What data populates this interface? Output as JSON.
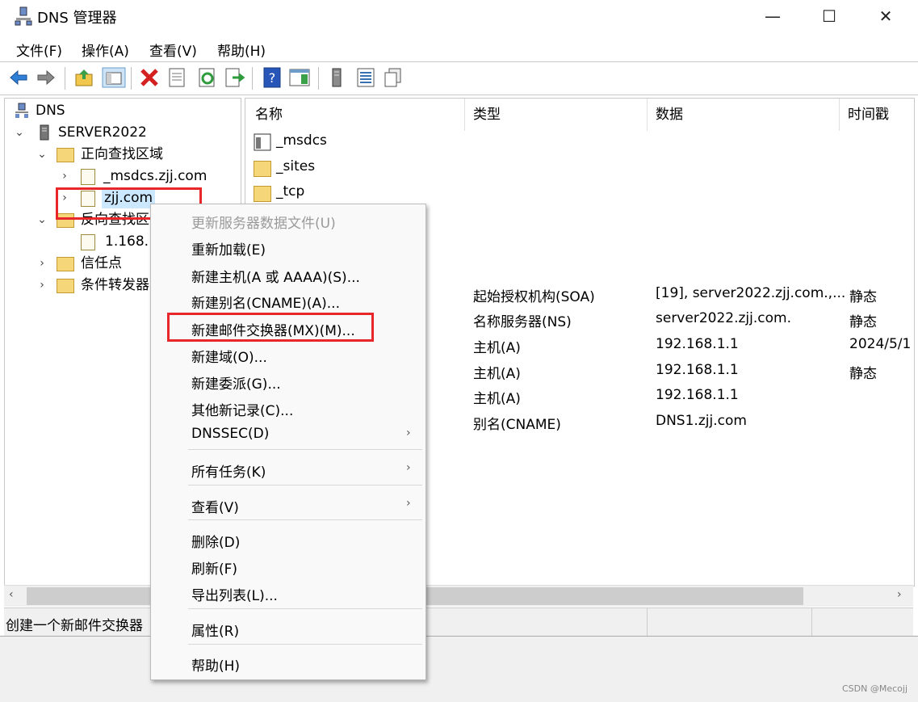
{
  "window": {
    "title": "DNS 管理器",
    "minimize": "—",
    "maximize": "☐",
    "close": "✕"
  },
  "menubar": [
    "文件(F)",
    "操作(A)",
    "查看(V)",
    "帮助(H)"
  ],
  "toolbar_icons": [
    "back-icon",
    "forward-icon",
    "up-folder-icon",
    "show-hide-tree-icon",
    "delete-icon",
    "properties-icon",
    "refresh-icon",
    "export-icon",
    "help-icon",
    "action-pane-icon",
    "server-icon",
    "list-icon",
    "copy-icon"
  ],
  "tree": {
    "root": "DNS",
    "server": "SERVER2022",
    "forward_zones": "正向查找区域",
    "zone_msdcs": "_msdcs.zjj.com",
    "zone_zjj": "zjj.com",
    "reverse_zones": "反向查找区",
    "reverse_zone": "1.168.1",
    "trust_points": "信任点",
    "conditional_forwarders": "条件转发器"
  },
  "list": {
    "columns": [
      "名称",
      "类型",
      "数据",
      "时间戳"
    ],
    "folders": [
      "_msdcs",
      "_sites",
      "_tcp"
    ],
    "records": [
      {
        "type": "起始授权机构(SOA)",
        "data": "[19], server2022.zjj.com.,...",
        "timestamp": "静态"
      },
      {
        "type": "名称服务器(NS)",
        "data": "server2022.zjj.com.",
        "timestamp": "静态"
      },
      {
        "type": "主机(A)",
        "data": "192.168.1.1",
        "timestamp": "2024/5/1"
      },
      {
        "type": "主机(A)",
        "data": "192.168.1.1",
        "timestamp": "静态"
      },
      {
        "type": "主机(A)",
        "data": "192.168.1.1",
        "timestamp": ""
      },
      {
        "type": "别名(CNAME)",
        "data": "DNS1.zjj.com",
        "timestamp": ""
      }
    ]
  },
  "context_menu": {
    "update": "更新服务器数据文件(U)",
    "reload": "重新加载(E)",
    "new_host": "新建主机(A 或 AAAA)(S)...",
    "new_alias": "新建别名(CNAME)(A)...",
    "new_mx": "新建邮件交换器(MX)(M)...",
    "new_domain": "新建域(O)...",
    "new_delegation": "新建委派(G)...",
    "other_records": "其他新记录(C)...",
    "dnssec": "DNSSEC(D)",
    "all_tasks": "所有任务(K)",
    "view": "查看(V)",
    "delete": "删除(D)",
    "refresh": "刷新(F)",
    "export": "导出列表(L)...",
    "properties": "属性(R)",
    "help": "帮助(H)",
    "submenu_arrow": "›"
  },
  "status": "创建一个新邮件交换器",
  "watermark": "CSDN @Mecojj",
  "highlight_color": "#e8272b"
}
